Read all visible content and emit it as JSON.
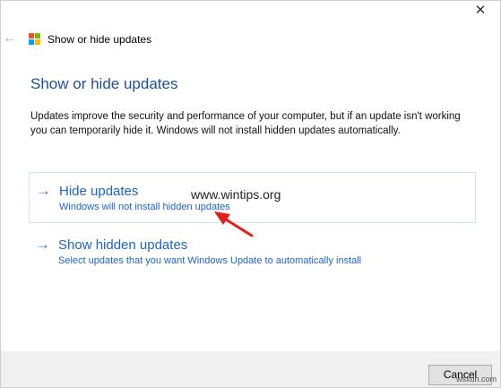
{
  "titlebar": {
    "close_glyph": "✕",
    "back_glyph": "←",
    "window_title": "Show or hide updates"
  },
  "page": {
    "heading": "Show or hide updates",
    "description": "Updates improve the security and performance of your computer, but if an update isn't working you can temporarily hide it. Windows will not install hidden updates automatically."
  },
  "options": [
    {
      "title": "Hide updates",
      "subtitle": "Windows will not install hidden updates"
    },
    {
      "title": "Show hidden updates",
      "subtitle": "Select updates that you want Windows Update to automatically install"
    }
  ],
  "watermark": "www.wintips.org",
  "footer": {
    "cancel_label": "Cancel",
    "brand": "wsxdn.com"
  },
  "colors": {
    "link_blue": "#1f64c7",
    "heading_blue": "#1f4e9c",
    "pointer_red": "#e0201b"
  },
  "icons": {
    "arrow_glyph": "→"
  }
}
